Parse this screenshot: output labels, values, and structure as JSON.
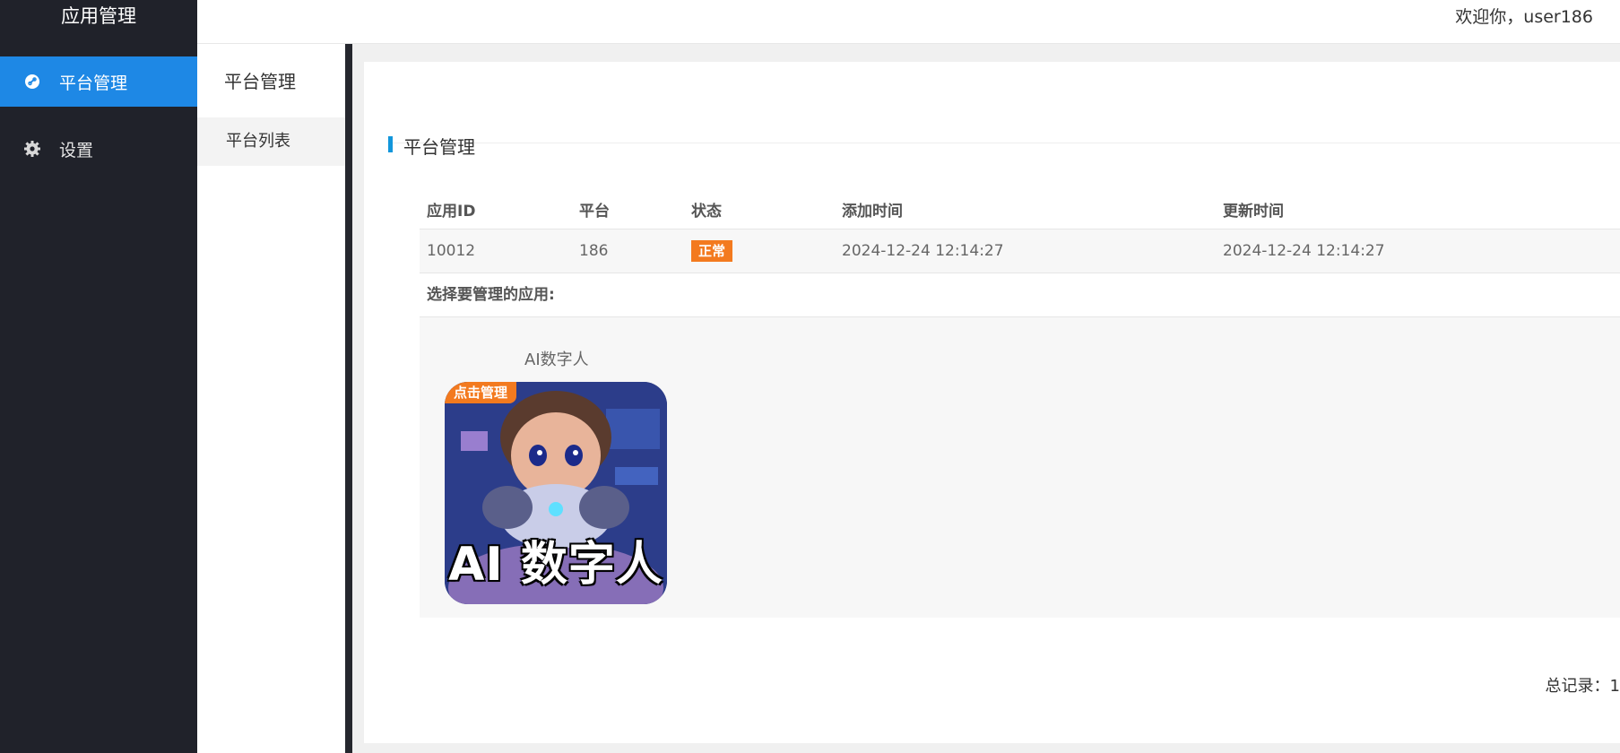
{
  "sidebar": {
    "brand": "应用管理",
    "items": [
      {
        "label": "平台管理",
        "icon": "link-icon"
      },
      {
        "label": "设置",
        "icon": "gear-icon"
      }
    ]
  },
  "header": {
    "welcome": "欢迎你，user186"
  },
  "submenu": {
    "title": "平台管理",
    "items": [
      {
        "label": "平台列表"
      }
    ]
  },
  "card": {
    "title": "平台管理",
    "table": {
      "headers": [
        "应用ID",
        "平台",
        "状态",
        "添加时间",
        "更新时间"
      ],
      "rows": [
        {
          "app_id": "10012",
          "platform": "186",
          "status": "正常",
          "added": "2024-12-24 12:14:27",
          "updated": "2024-12-24 12:14:27"
        }
      ]
    },
    "select_label": "选择要管理的应用:",
    "apps": [
      {
        "name": "AI数字人",
        "tag": "点击管理",
        "caption": "AI 数字人"
      }
    ],
    "total": "总记录：1"
  },
  "colors": {
    "accent": "#1e88e5",
    "badge": "#f37a1f",
    "sidebar_bg": "#20222a"
  }
}
